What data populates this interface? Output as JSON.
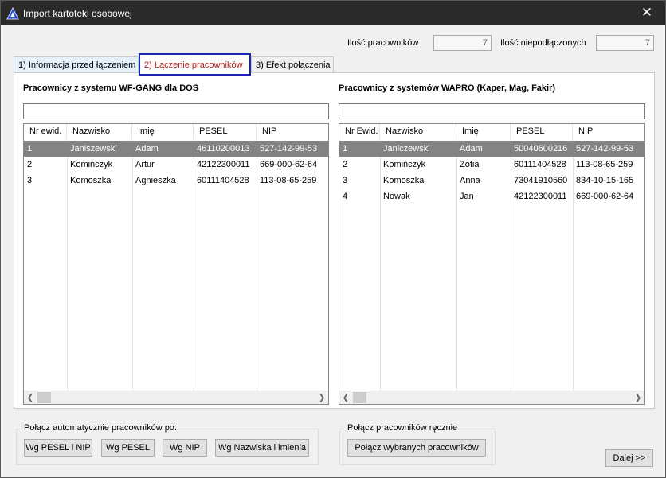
{
  "window": {
    "title": "Import kartoteki osobowej",
    "close_glyph": "✕"
  },
  "counters": {
    "employees_label": "Ilość pracowników",
    "employees_value": "7",
    "unlinked_label": "Ilość niepodłączonych",
    "unlinked_value": "7"
  },
  "tabs": [
    {
      "label": "1) Informacja przed łączeniem"
    },
    {
      "label": "2) Łączenie pracowników"
    },
    {
      "label": "3) Efekt połączenia"
    }
  ],
  "left_panel": {
    "title": "Pracownicy z systemu WF-GANG dla DOS",
    "filter_value": "",
    "columns": [
      "Nr ewid.",
      "Nazwisko",
      "Imię",
      "PESEL",
      "NIP"
    ],
    "rows": [
      {
        "nr": "1",
        "nazwisko": "Janiszewski",
        "imie": "Adam",
        "pesel": "46110200013",
        "nip": "527-142-99-53"
      },
      {
        "nr": "2",
        "nazwisko": "Komińczyk",
        "imie": "Artur",
        "pesel": "42122300011",
        "nip": "669-000-62-64"
      },
      {
        "nr": "3",
        "nazwisko": "Komoszka",
        "imie": "Agnieszka",
        "pesel": "60111404528",
        "nip": "113-08-65-259"
      }
    ]
  },
  "right_panel": {
    "title": "Pracownicy z systemów WAPRO (Kaper, Mag, Fakir)",
    "filter_value": "",
    "columns": [
      "Nr Ewid.",
      "Nazwisko",
      "Imię",
      "PESEL",
      "NIP"
    ],
    "rows": [
      {
        "nr": "1",
        "nazwisko": "Janiczewski",
        "imie": "Adam",
        "pesel": "50040600216",
        "nip": "527-142-99-53"
      },
      {
        "nr": "2",
        "nazwisko": "Komińczyk",
        "imie": "Zofia",
        "pesel": "60111404528",
        "nip": "113-08-65-259"
      },
      {
        "nr": "3",
        "nazwisko": "Komoszka",
        "imie": "Anna",
        "pesel": "73041910560",
        "nip": "834-10-15-165"
      },
      {
        "nr": "4",
        "nazwisko": "Nowak",
        "imie": "Jan",
        "pesel": "42122300011",
        "nip": "669-000-62-64"
      }
    ]
  },
  "auto_group": {
    "legend": "Połącz automatycznie pracowników po:",
    "buttons": [
      "Wg PESEL i NIP",
      "Wg PESEL",
      "Wg NIP",
      "Wg Nazwiska i imienia"
    ]
  },
  "manual_group": {
    "legend": "Połącz pracowników ręcznie",
    "button": "Połącz wybranych pracowników"
  },
  "next_button": "Dalej >>",
  "colors": {
    "titlebar": "#2b2b2b",
    "selected_row": "#838383",
    "active_tab_border": "#1428b4",
    "active_tab_text": "#b22222"
  }
}
